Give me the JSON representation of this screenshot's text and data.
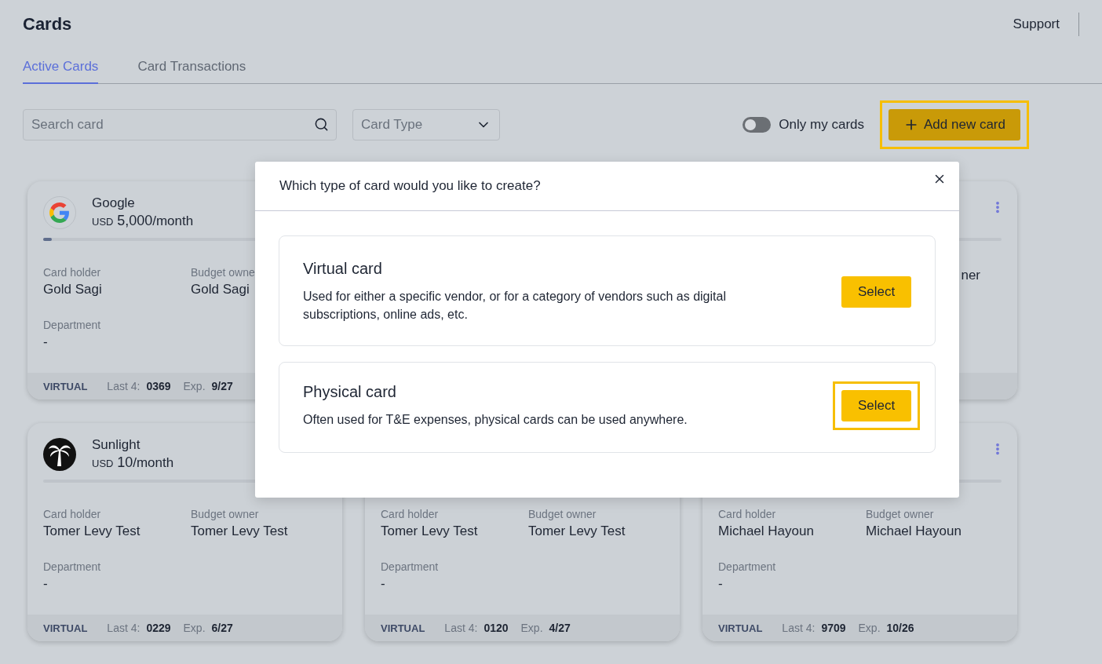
{
  "header": {
    "title": "Cards",
    "support_link": "Support"
  },
  "tabs": [
    {
      "label": "Active Cards",
      "selected": true
    },
    {
      "label": "Card Transactions",
      "selected": false
    }
  ],
  "search": {
    "placeholder": "Search card"
  },
  "card_type_filter": {
    "placeholder": "Card Type"
  },
  "only_my_cards": {
    "label": "Only my cards",
    "on": false
  },
  "add_button": {
    "label": "Add new card",
    "highlighted": true
  },
  "cards": [
    {
      "kind": "google",
      "name": "Google",
      "currency": "USD",
      "amount": "5,000",
      "period": "/month",
      "level": 0.03,
      "holder_label": "Card holder",
      "holder_value": "Gold Sagi",
      "owner_label": "Budget owne",
      "owner_value": "Gold Sagi",
      "department_label": "Department",
      "department_value": "-",
      "type": "VIRTUAL",
      "last4_label": "Last 4:",
      "last4": "0369",
      "exp_label": "Exp.",
      "exp": "9/27"
    },
    {
      "owner_value": "ner"
    },
    {
      "kind": "palm",
      "name": "Sunlight",
      "currency": "USD",
      "amount": "10",
      "period": "/month",
      "holder_label": "Card holder",
      "holder_value": "Tomer Levy Test",
      "owner_label": "Budget owner",
      "owner_value": "Tomer Levy Test",
      "department_label": "Department",
      "department_value": "-",
      "type": "VIRTUAL",
      "last4_label": "Last 4:",
      "last4": "0229",
      "exp_label": "Exp.",
      "exp": "6/27"
    },
    {
      "holder_label": "Card holder",
      "holder_value": "Tomer Levy Test",
      "owner_label": "Budget owner",
      "owner_value": "Tomer Levy Test",
      "department_label": "Department",
      "department_value": "-",
      "type": "VIRTUAL",
      "last4_label": "Last 4:",
      "last4": "0120",
      "exp_label": "Exp.",
      "exp": "4/27"
    },
    {
      "holder_label": "Card holder",
      "holder_value": "Michael Hayoun",
      "owner_label": "Budget owner",
      "owner_value": "Michael Hayoun",
      "department_label": "Department",
      "department_value": "-",
      "type": "VIRTUAL",
      "last4_label": "Last 4:",
      "last4": "9709",
      "exp_label": "Exp.",
      "exp": "10/26"
    }
  ],
  "dialog": {
    "title": "Which type of card would you like to create?",
    "options": [
      {
        "title": "Virtual card",
        "description": "Used for either a specific vendor, or for a category of vendors such as digital subscriptions, online ads, etc.",
        "button": "Select",
        "highlighted": false
      },
      {
        "title": "Physical card",
        "description": "Often used for T&E expenses, physical cards can be used anywhere.",
        "button": "Select",
        "highlighted": true
      }
    ]
  }
}
